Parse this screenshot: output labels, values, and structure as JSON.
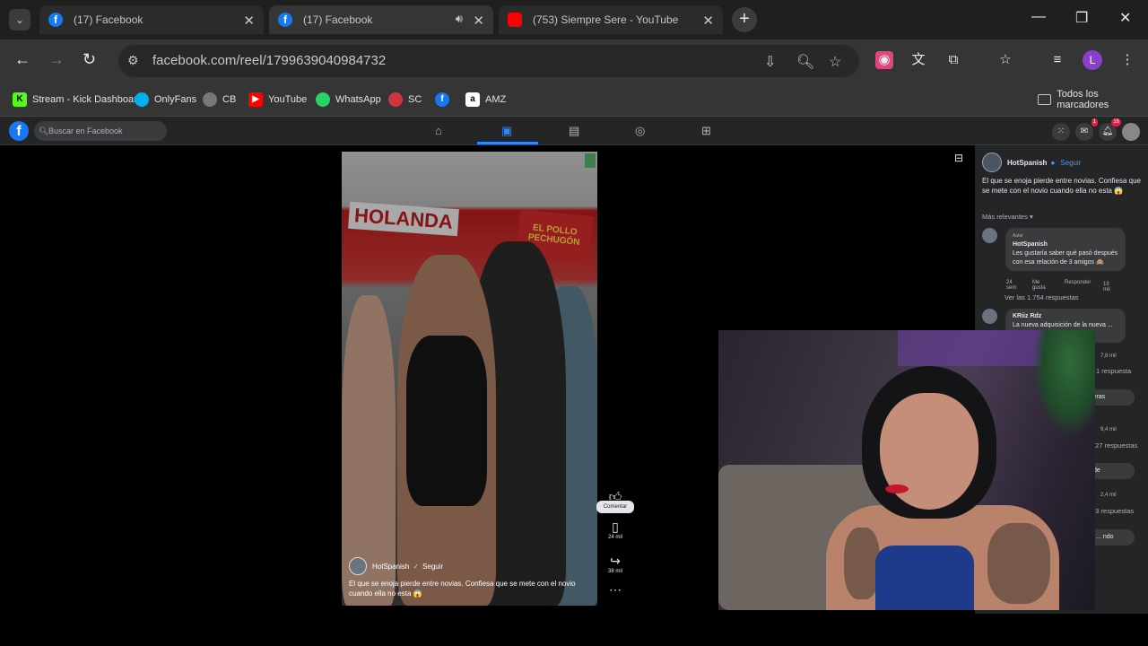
{
  "browser": {
    "tabs": [
      {
        "title": "(17) Facebook",
        "active": false
      },
      {
        "title": "(17) Facebook",
        "active": true
      },
      {
        "title": "(753) Siempre Sere - YouTube",
        "active": false
      }
    ],
    "url": "facebook.com/reel/1799639040984732",
    "bookmarks": [
      {
        "label": "Stream - Kick Dashboard",
        "icon": "kick-icon",
        "color": "#53fc18"
      },
      {
        "label": "OnlyFans",
        "icon": "onlyfans-icon",
        "color": "#00aff0"
      },
      {
        "label": "CB",
        "icon": "cb-icon",
        "color": "#f47321"
      },
      {
        "label": "YouTube",
        "icon": "youtube-icon",
        "color": "#ff0000"
      },
      {
        "label": "WhatsApp",
        "icon": "whatsapp-icon",
        "color": "#25d366"
      },
      {
        "label": "SC",
        "icon": "soundcloud-icon",
        "color": "#ff5500"
      },
      {
        "label": "",
        "icon": "facebook-icon",
        "color": "#1877f2"
      },
      {
        "label": "AMZ",
        "icon": "amazon-icon",
        "color": "#ff9900"
      }
    ],
    "all_bookmarks": "Todos los marcadores",
    "profile_initial": "L"
  },
  "facebook": {
    "search_placeholder": "Buscar en Facebook",
    "messenger_badge": "1",
    "notif_badge": "16"
  },
  "reel": {
    "author": "HotSpanish",
    "follow": "Seguir",
    "caption": "El que se enoja pierde entre novias. Confiesa que se mete con el novio cuando ella no esta 😱",
    "sign_text": "HOLANDA",
    "sign2_text": "EL POLLO PECHUGÓN",
    "tooltip": "Comentar",
    "comment_count": "24 mil",
    "share_count": "38 mil"
  },
  "sidebar": {
    "author": "HotSpanish",
    "follow": "Seguir",
    "description": "El que se enoja pierde entre novias. Confiesa que se mete con el novio cuando ella no esta 😱",
    "sort": "Más relevantes",
    "comments": [
      {
        "badge": "Autor",
        "name": "HotSpanish",
        "text": "Les gustaría saber qué pasó después con esa relación de 3 amigos 🙈",
        "time": "24 sem",
        "like": "Me gusta",
        "reply": "Responder",
        "reactions": "19 mil",
        "replies": "Ver las 1.754 respuestas"
      },
      {
        "name": "KRiiz Rdz",
        "text": "La nueva adquisición de la nueva ... dre",
        "reactions": "7,8 mil",
        "replies": "1 respuesta"
      },
      {
        "text": "hot.. eras",
        "reactions": "9,4 mil",
        "replies": "127 respuestas"
      },
      {
        "text": "rada de",
        "reactions": "2,4 mil",
        "replies": "33 respuestas"
      },
      {
        "text": "rio ya ... ndo"
      }
    ]
  }
}
